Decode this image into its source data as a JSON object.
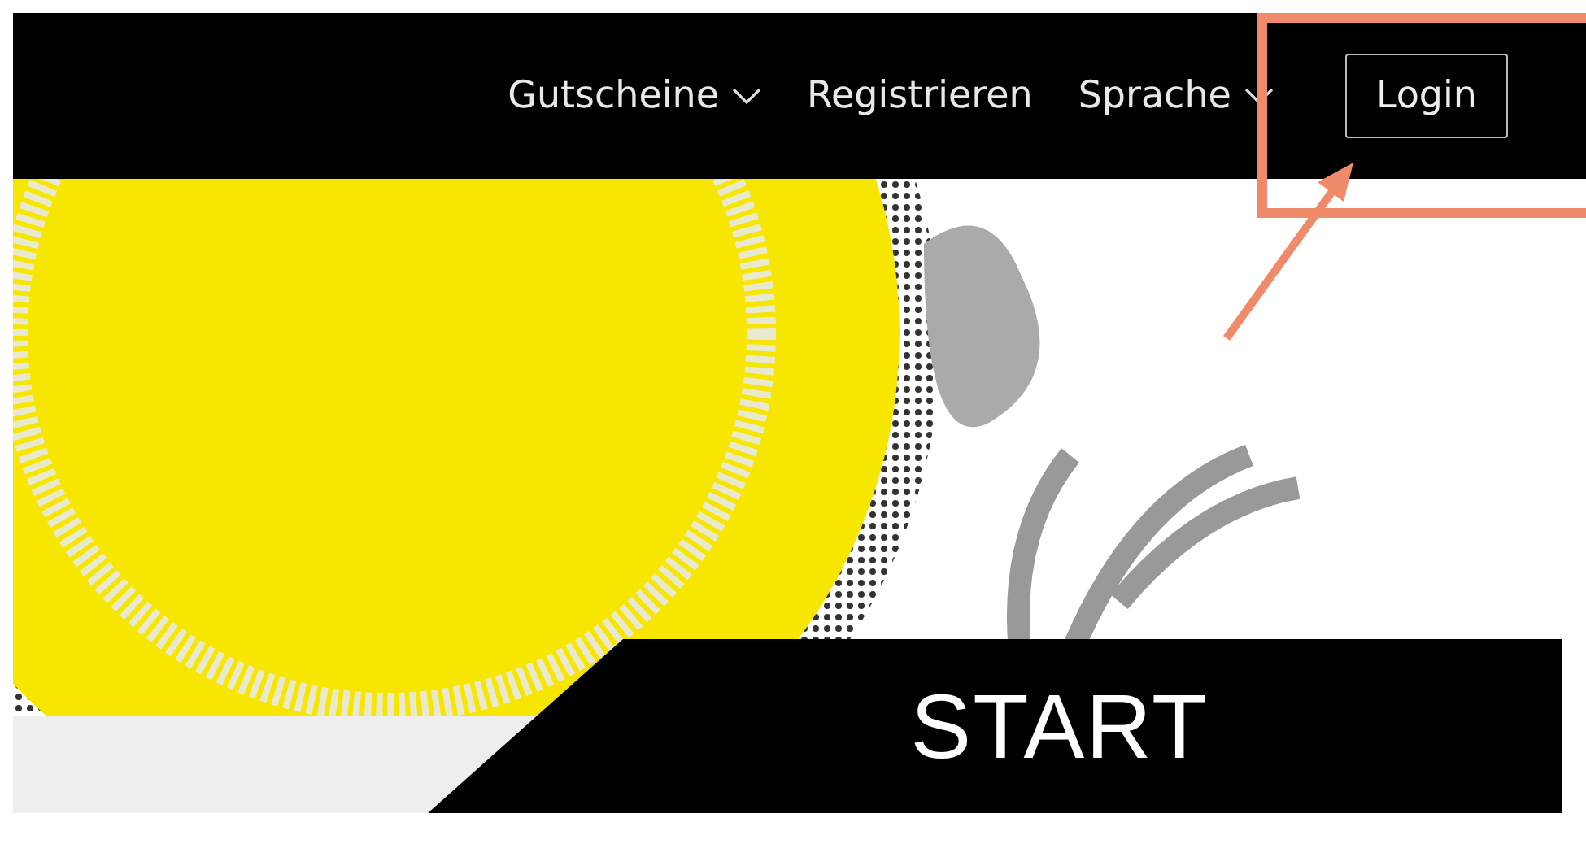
{
  "nav": {
    "items": [
      {
        "label": "Gutscheine",
        "kind": "dropdown"
      },
      {
        "label": "Registrieren",
        "kind": "link"
      },
      {
        "label": "Sprache",
        "kind": "dropdown"
      }
    ],
    "login": "Login"
  },
  "hero": {
    "banner": "START"
  }
}
